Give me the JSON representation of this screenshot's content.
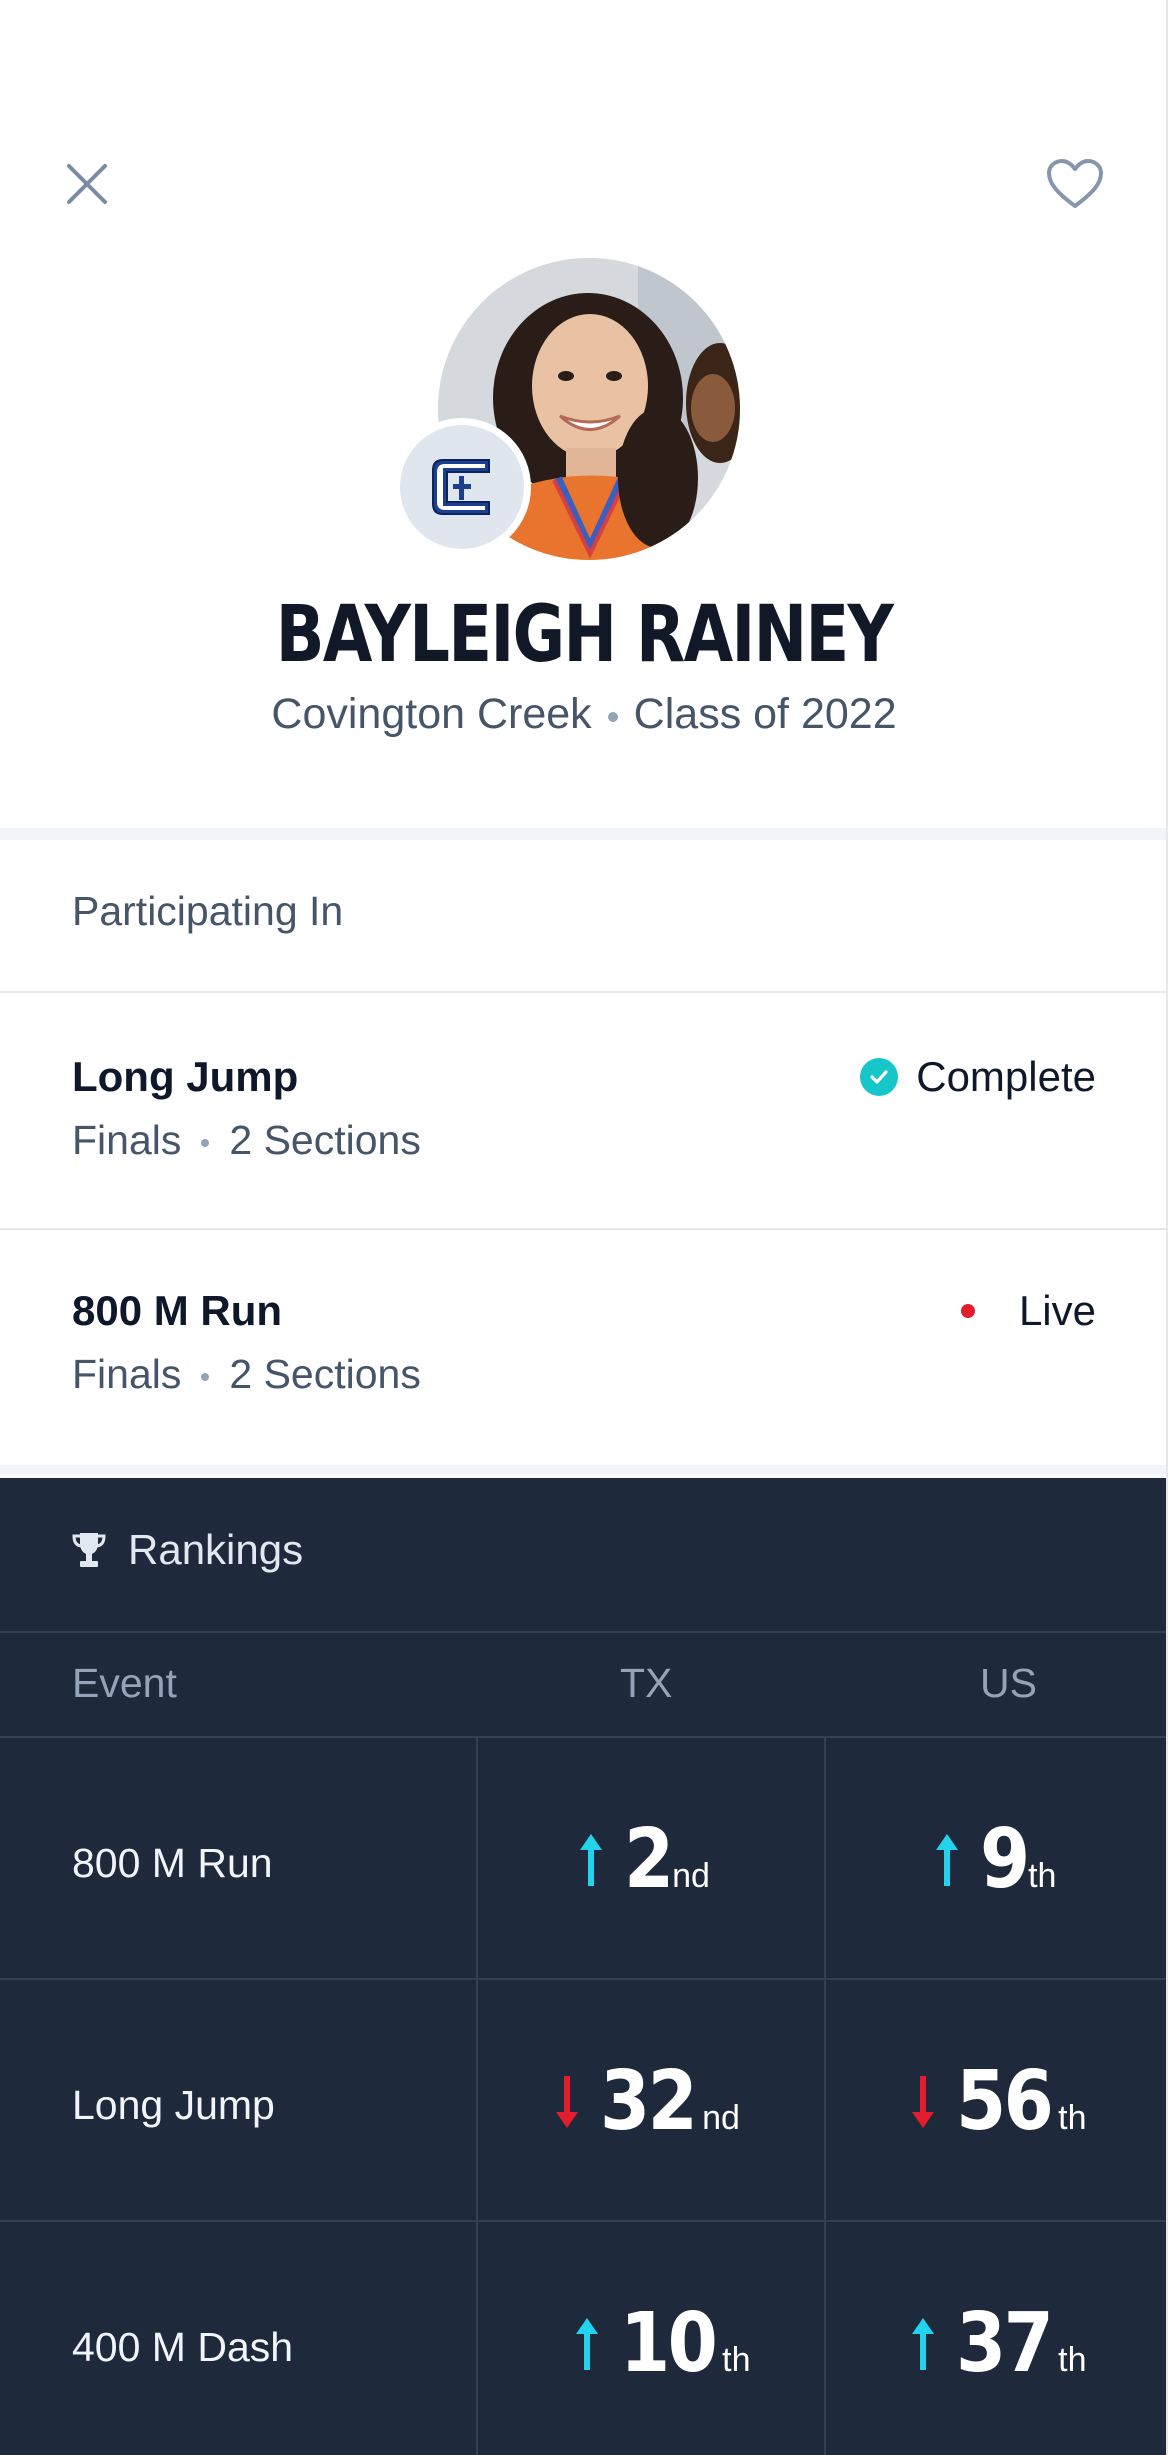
{
  "profile": {
    "name": "BAYLEIGH RAINEY",
    "school": "Covington Creek",
    "class_year": "Class of 2022"
  },
  "participating": {
    "title": "Participating In",
    "events": [
      {
        "name": "Long Jump",
        "round": "Finals",
        "sections": "2 Sections",
        "status": "Complete"
      },
      {
        "name": "800 M Run",
        "round": "Finals",
        "sections": "2 Sections",
        "status": "Live"
      }
    ]
  },
  "rankings": {
    "title": "Rankings",
    "columns": [
      "Event",
      "TX",
      "US"
    ],
    "rows": [
      {
        "event": "800 M Run",
        "tx": {
          "rank": "2",
          "suffix": "nd",
          "trend": "up"
        },
        "us": {
          "rank": "9",
          "suffix": "th",
          "trend": "up"
        }
      },
      {
        "event": "Long Jump",
        "tx": {
          "rank": "32",
          "suffix": "nd",
          "trend": "down"
        },
        "us": {
          "rank": "56",
          "suffix": "th",
          "trend": "down"
        }
      },
      {
        "event": "400 M Dash",
        "tx": {
          "rank": "10",
          "suffix": "th",
          "trend": "up"
        },
        "us": {
          "rank": "37",
          "suffix": "th",
          "trend": "up"
        }
      }
    ]
  },
  "colors": {
    "up_arrow": "#22d3ee",
    "down_arrow": "#e11d2e",
    "complete": "#16c6c9",
    "live": "#e11d2e",
    "rankings_bg": "#1e293b"
  }
}
